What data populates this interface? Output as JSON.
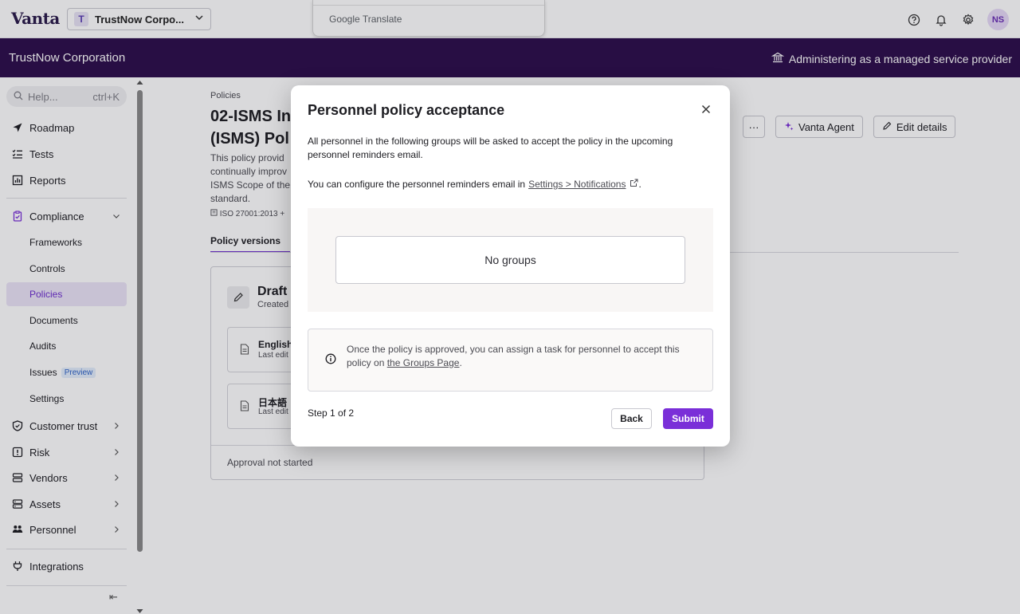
{
  "topbar": {
    "logo": "Vanta",
    "org_initial": "T",
    "org_name": "TrustNow Corpo...",
    "google_translate": "Google Translate",
    "user_initials": "NS",
    "icons": [
      "help-icon",
      "bell-icon",
      "gear-icon"
    ]
  },
  "band": {
    "org_title": "TrustNow Corporation",
    "msp_label": "Administering as a managed service provider"
  },
  "sidebar": {
    "help_placeholder": "Help...",
    "help_shortcut": "ctrl+K",
    "items": [
      {
        "label": "Roadmap",
        "icon": "send-icon"
      },
      {
        "label": "Tests",
        "icon": "list-check-icon"
      },
      {
        "label": "Reports",
        "icon": "chart-icon"
      },
      {
        "label": "Compliance",
        "icon": "clipboard-icon"
      },
      {
        "label": "Frameworks"
      },
      {
        "label": "Controls"
      },
      {
        "label": "Policies"
      },
      {
        "label": "Documents"
      },
      {
        "label": "Audits"
      },
      {
        "label": "Issues",
        "badge": "Preview"
      },
      {
        "label": "Settings"
      },
      {
        "label": "Customer trust",
        "icon": "shield-icon"
      },
      {
        "label": "Risk",
        "icon": "alert-icon"
      },
      {
        "label": "Vendors",
        "icon": "stack-icon"
      },
      {
        "label": "Assets",
        "icon": "server-icon"
      },
      {
        "label": "Personnel",
        "icon": "people-icon"
      },
      {
        "label": "Integrations",
        "icon": "plug-icon"
      }
    ],
    "collapse_glyph": "⇤"
  },
  "page": {
    "breadcrumb": "Policies",
    "title_line1": "02-ISMS In",
    "title_line2": "(ISMS) Pol",
    "description": "This policy provid continually improv ISMS Scope of the standard.",
    "framework": "ISO 27001:2013 +",
    "tab_active": "Policy versions",
    "more_button": "···",
    "agent_button": "Vanta Agent",
    "edit_button": "Edit details",
    "draft": {
      "title": "Draft",
      "subtitle": "Created",
      "versions": [
        {
          "title": "English",
          "subtitle": "Last edit"
        },
        {
          "title": "日本語",
          "subtitle": "Last edit"
        }
      ],
      "approval_status": "Approval not started"
    }
  },
  "modal": {
    "title": "Personnel policy acceptance",
    "paragraph1": "All personnel in the following groups will be asked to accept the policy in the upcoming personnel reminders email.",
    "paragraph2_prefix": "You can configure the personnel reminders email in",
    "settings_link": "Settings > Notifications",
    "paragraph2_suffix": ".",
    "no_groups": "No groups",
    "info_prefix": "Once the policy is approved, you can assign a task for personnel to accept this policy on",
    "groups_link": "the Groups Page",
    "info_suffix": ".",
    "step": "Step 1 of 2",
    "back_button": "Back",
    "submit_button": "Submit"
  },
  "colors": {
    "brand_purple": "#2d0e4c",
    "accent": "#7a2fd8",
    "active_nav_bg": "#ebe4f7"
  }
}
